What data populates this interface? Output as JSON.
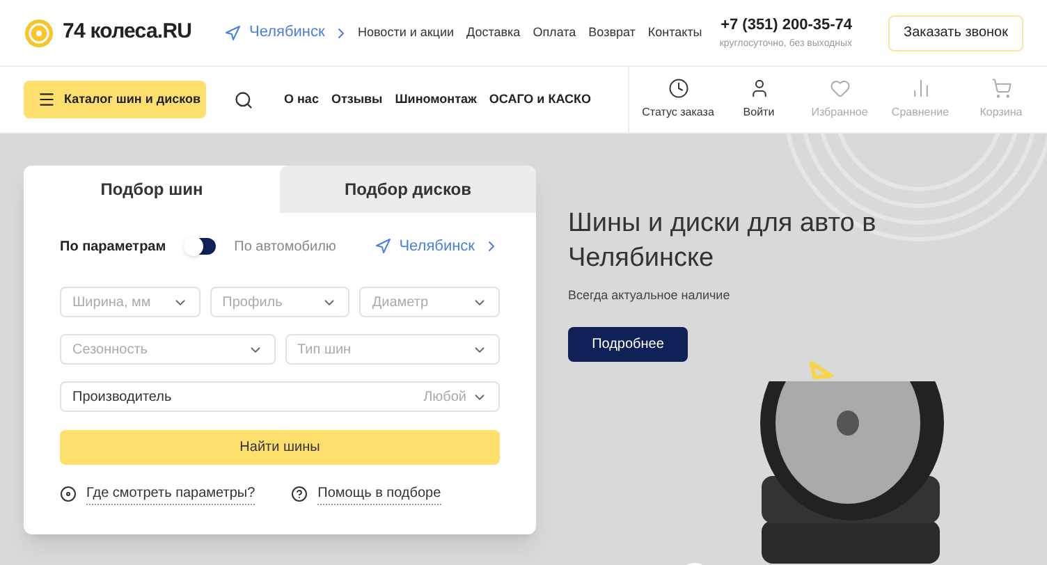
{
  "header": {
    "logo_text": "74 колеса.RU",
    "city": "Челябинск",
    "nav": [
      "Новости и акции",
      "Доставка",
      "Оплата",
      "Возврат",
      "Контакты"
    ],
    "phone": "+7 (351) 200-35-74",
    "phone_note": "круглосуточно, без выходных",
    "callback_button": "Заказать звонок"
  },
  "toolbar": {
    "catalog_button": "Каталог шин и дисков",
    "links": [
      "О нас",
      "Отзывы",
      "Шиномонтаж",
      "ОСАГО и КАСКО"
    ],
    "actions": [
      {
        "kind": "clock",
        "label": "Статус заказа",
        "disabled": false
      },
      {
        "kind": "user",
        "label": "Войти",
        "disabled": false
      },
      {
        "kind": "heart",
        "label": "Избранное",
        "disabled": true
      },
      {
        "kind": "bars",
        "label": "Сравнение",
        "disabled": true
      },
      {
        "kind": "cart",
        "label": "Корзина",
        "disabled": true
      }
    ]
  },
  "picker": {
    "tabs": [
      {
        "label": "Подбор шин",
        "selected": true
      },
      {
        "label": "Подбор дисков",
        "selected": false
      }
    ],
    "modes": [
      {
        "label": "По параметрам",
        "selected": true
      },
      {
        "label": "По автомобилю",
        "selected": false
      }
    ],
    "by_car": false,
    "city": "Челябинск",
    "selects_row1": [
      {
        "placeholder": "Ширина, мм"
      },
      {
        "placeholder": "Профиль"
      },
      {
        "placeholder": "Диаметр"
      }
    ],
    "selects_row2": [
      {
        "placeholder": "Сезонность"
      },
      {
        "placeholder": "Тип шин"
      }
    ],
    "maker": {
      "label": "Производитель",
      "value": "Любой"
    },
    "submit": "Найти шины",
    "help_links": [
      {
        "kind": "wheel",
        "label": "Где смотреть параметры?"
      },
      {
        "kind": "question",
        "label": "Помощь в подборе"
      }
    ]
  },
  "hero": {
    "title": "Шины и диски для авто в Челябинске",
    "subtitle": "Всегда актуальное наличие",
    "button": "Подробнее"
  }
}
